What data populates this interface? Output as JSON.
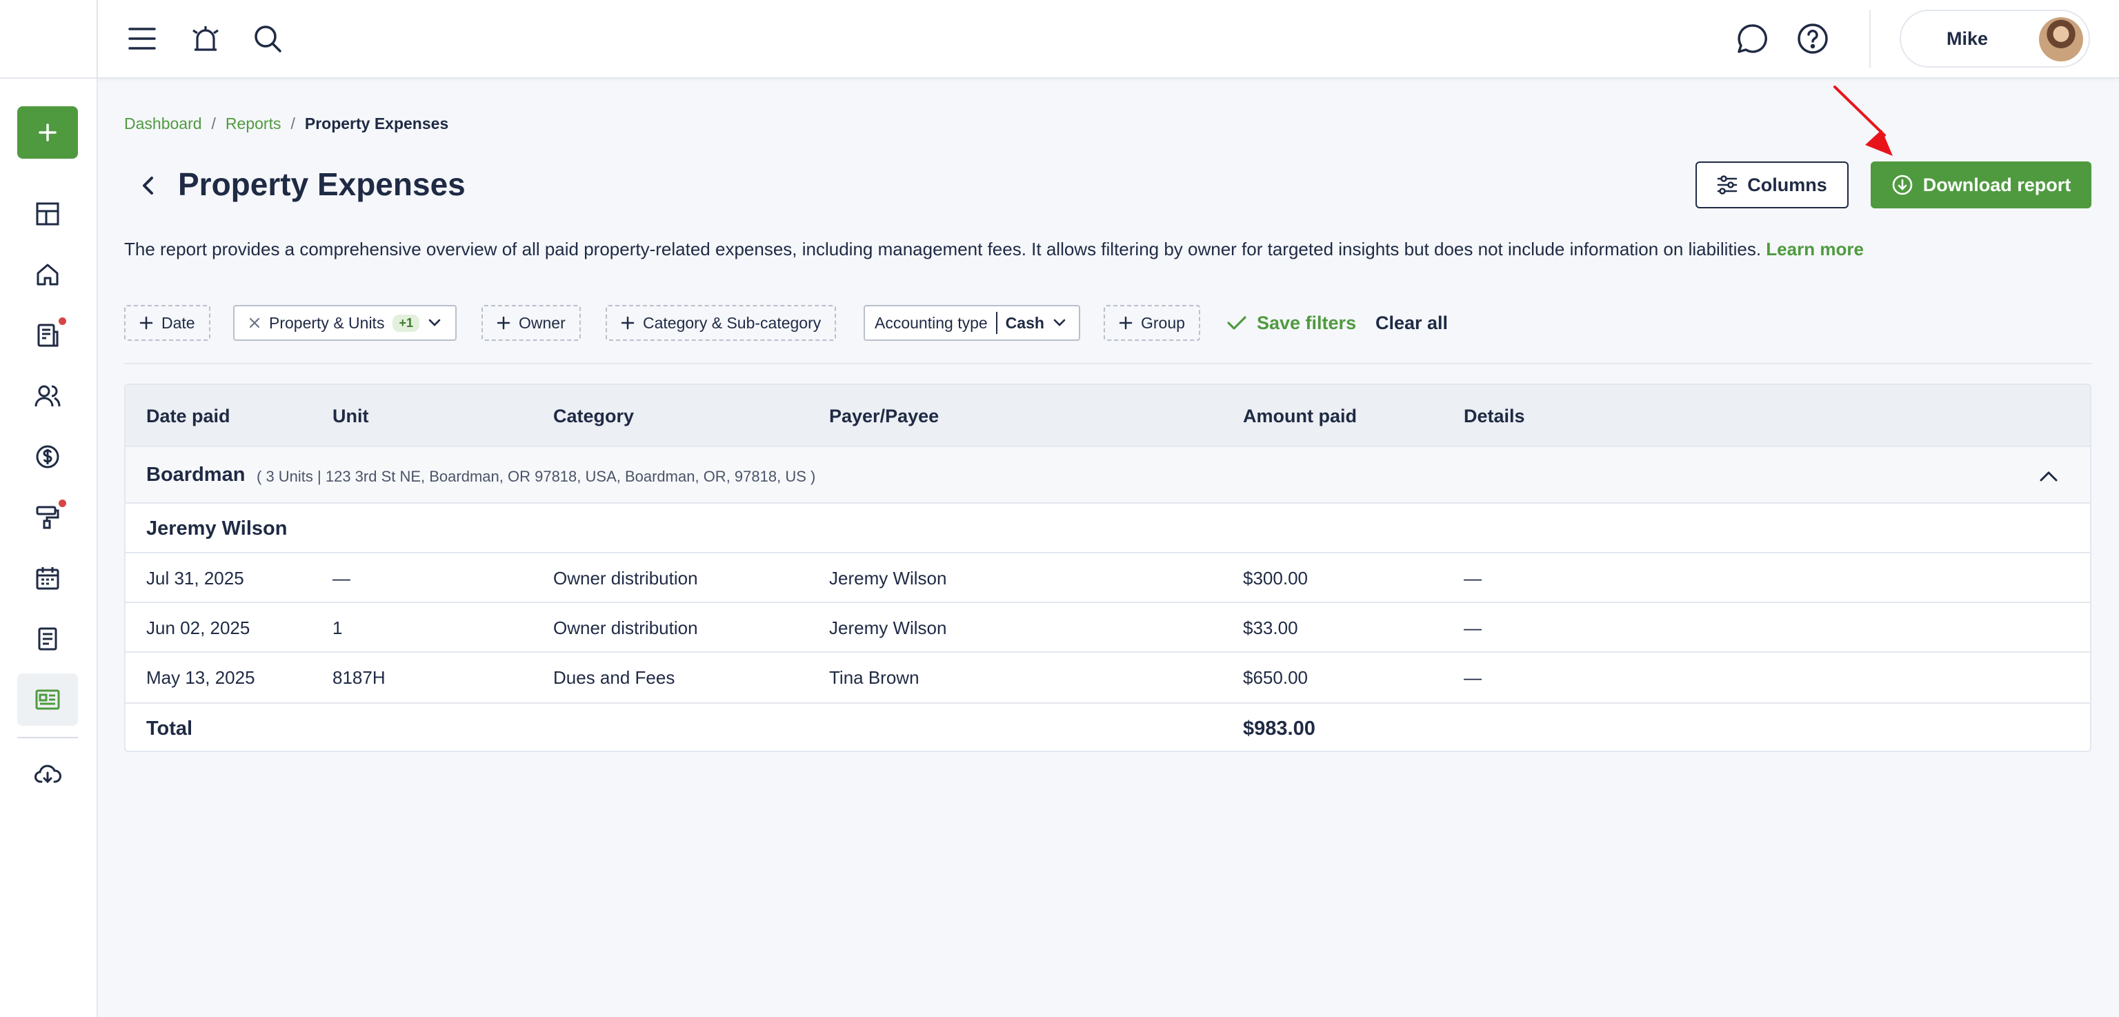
{
  "header": {
    "user_name": "Mike"
  },
  "breadcrumb": {
    "items": [
      "Dashboard",
      "Reports"
    ],
    "separator": "/",
    "current": "Property Expenses"
  },
  "page": {
    "title": "Property Expenses",
    "columns_label": "Columns",
    "download_label": "Download report",
    "description": "The report provides a comprehensive overview of all paid property-related expenses, including management fees. It allows filtering by owner for targeted insights but does not include information on liabilities.",
    "learn_more": "Learn more"
  },
  "filters": {
    "date": "Date",
    "property_units": "Property & Units",
    "property_units_badge": "+1",
    "owner": "Owner",
    "category": "Category & Sub-category",
    "accounting_label": "Accounting type",
    "accounting_value": "Cash",
    "group": "Group",
    "save": "Save filters",
    "clear": "Clear all"
  },
  "table": {
    "columns": [
      "Date paid",
      "Unit",
      "Category",
      "Payer/Payee",
      "Amount paid",
      "Details"
    ],
    "group": {
      "name": "Boardman",
      "meta": "( 3 Units | 123 3rd St NE, Boardman, OR 97818, USA, Boardman, OR, 97818, US )"
    },
    "owner": "Jeremy Wilson",
    "rows": [
      {
        "date": "Jul 31, 2025",
        "unit": "—",
        "category": "Owner distribution",
        "payee": "Jeremy Wilson",
        "amount": "$300.00",
        "details": "—"
      },
      {
        "date": "Jun 02, 2025",
        "unit": "1",
        "category": "Owner distribution",
        "payee": "Jeremy Wilson",
        "amount": "$33.00",
        "details": "—"
      },
      {
        "date": "May 13, 2025",
        "unit": "8187H",
        "category": "Dues and Fees",
        "payee": "Tina Brown",
        "amount": "$650.00",
        "details": "—"
      }
    ],
    "total_label": "Total",
    "total_value": "$983.00"
  },
  "colors": {
    "accent": "#4f9a3f",
    "text": "#1f2a44",
    "notification": "#d64545",
    "annotation_arrow": "#e8141c"
  }
}
